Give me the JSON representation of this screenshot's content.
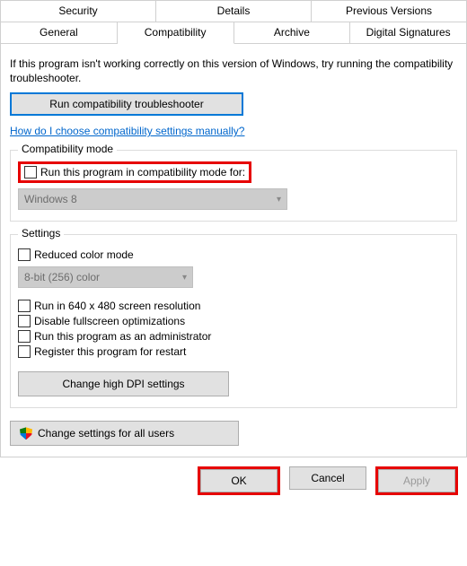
{
  "tabs_row1": [
    "Security",
    "Details",
    "Previous Versions"
  ],
  "tabs_row2": [
    "General",
    "Compatibility",
    "Archive",
    "Digital Signatures"
  ],
  "active_tab": "Compatibility",
  "intro": "If this program isn't working correctly on this version of Windows, try running the compatibility troubleshooter.",
  "run_troubleshooter": "Run compatibility troubleshooter",
  "help_link": "How do I choose compatibility settings manually?",
  "compat_group": {
    "title": "Compatibility mode",
    "checkbox": "Run this program in compatibility mode for:",
    "select": "Windows 8"
  },
  "settings_group": {
    "title": "Settings",
    "reduced_color": "Reduced color mode",
    "color_select": "8-bit (256) color",
    "run_640": "Run in 640 x 480 screen resolution",
    "disable_fs": "Disable fullscreen optimizations",
    "run_admin": "Run this program as an administrator",
    "register_restart": "Register this program for restart",
    "dpi_btn": "Change high DPI settings"
  },
  "all_users_btn": "Change settings for all users",
  "footer": {
    "ok": "OK",
    "cancel": "Cancel",
    "apply": "Apply"
  }
}
